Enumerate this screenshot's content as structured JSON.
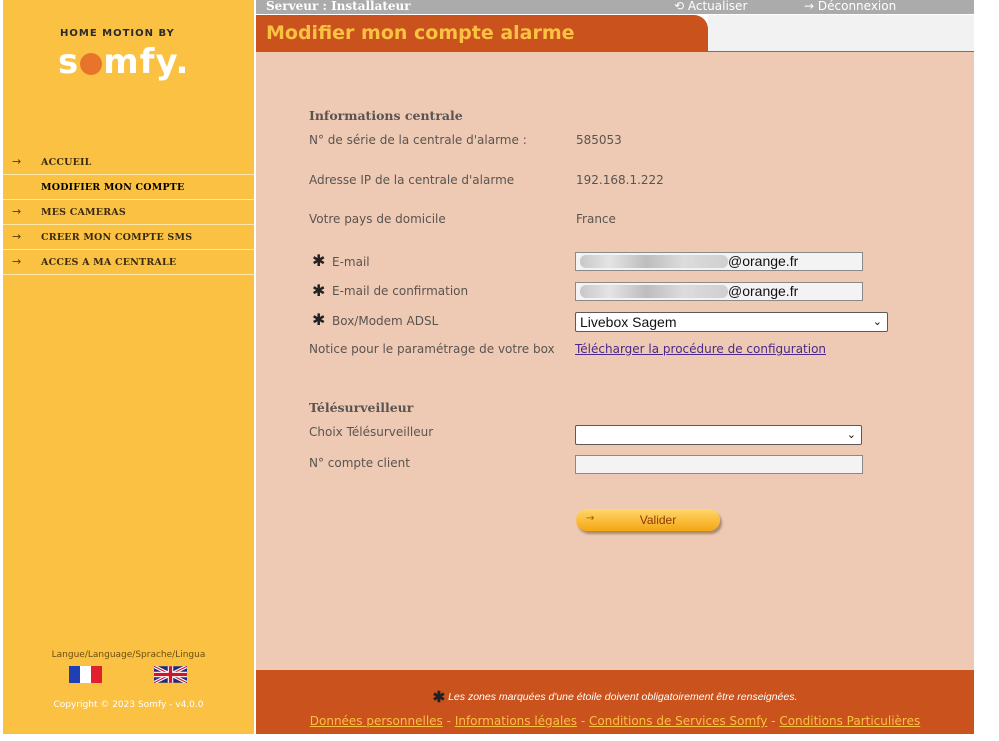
{
  "brand": {
    "tagline": "HOME MOTION BY",
    "name_pre": "s",
    "name_post": "mfy."
  },
  "sidebar": {
    "items": [
      {
        "label": "ACCUEIL",
        "arrow": "→"
      },
      {
        "label": "MODIFIER MON COMPTE",
        "arrow": ""
      },
      {
        "label": "MES CAMERAS",
        "arrow": "→"
      },
      {
        "label": "CREER MON COMPTE SMS",
        "arrow": "→"
      },
      {
        "label": "ACCES A MA CENTRALE",
        "arrow": "→"
      }
    ],
    "language_label": "Langue/Language/Sprache/Lingua",
    "copyright": "Copyright © 2023 Somfy - v4.0.0"
  },
  "topbar": {
    "server": "Serveur : Installateur",
    "refresh": "Actualiser",
    "logout": "Déconnexion"
  },
  "page": {
    "title": "Modifier mon compte alarme"
  },
  "central": {
    "section_title": "Informations centrale",
    "serial_label": "N° de série de la centrale d'alarme :",
    "serial_value": "585053",
    "ip_label": "Adresse IP de la centrale d'alarme",
    "ip_value": "192.168.1.222",
    "country_label": "Votre pays de domicile",
    "country_value": "France",
    "email_label": "E-mail",
    "email_domain": "@orange.fr",
    "email_confirm_label": "E-mail de confirmation",
    "email_confirm_domain": "@orange.fr",
    "box_label": "Box/Modem ADSL",
    "box_value": "Livebox Sagem",
    "notice_label": "Notice pour le paramétrage de votre box",
    "notice_link": "Télécharger la procédure de configuration",
    "required_star": "✱"
  },
  "monitoring": {
    "section_title": "Télésurveilleur",
    "choice_label": "Choix Télésurveilleur",
    "choice_value": "",
    "account_label": "N° compte client",
    "account_value": ""
  },
  "actions": {
    "validate_label": "Valider"
  },
  "footer": {
    "note": "Les zones marquées d'une étoile doivent obligatoirement être renseignées.",
    "links": [
      "Données personnelles",
      "Informations légales",
      "Conditions de Services Somfy",
      "Conditions Particulières"
    ],
    "separator": "-"
  },
  "colors": {
    "sidebar": "#fbc142",
    "accent": "#c9521d",
    "content_bg": "#eecab4"
  }
}
